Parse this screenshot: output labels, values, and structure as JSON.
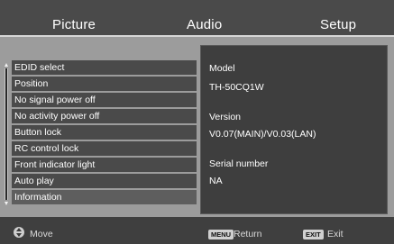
{
  "tabs": [
    {
      "label": "Picture"
    },
    {
      "label": "Audio"
    },
    {
      "label": "Setup"
    }
  ],
  "menu": {
    "items": [
      {
        "label": "EDID select"
      },
      {
        "label": "Position"
      },
      {
        "label": "No signal power off"
      },
      {
        "label": "No activity power off"
      },
      {
        "label": "Button lock"
      },
      {
        "label": "RC control lock"
      },
      {
        "label": "Front indicator light"
      },
      {
        "label": "Auto play"
      },
      {
        "label": "Information"
      }
    ],
    "selected_index": 8
  },
  "info": {
    "model_heading": "Model",
    "model_value": "TH-50CQ1W",
    "version_heading": "Version",
    "version_value": "V0.07(MAIN)/V0.03(LAN)",
    "serial_heading": "Serial number",
    "serial_value": "NA"
  },
  "help": {
    "move_label": "Move",
    "menu_key": "MENU",
    "return_label": "Return",
    "exit_key": "EXIT",
    "exit_label": "Exit",
    "move_icon": "up-down-arrows-icon"
  }
}
